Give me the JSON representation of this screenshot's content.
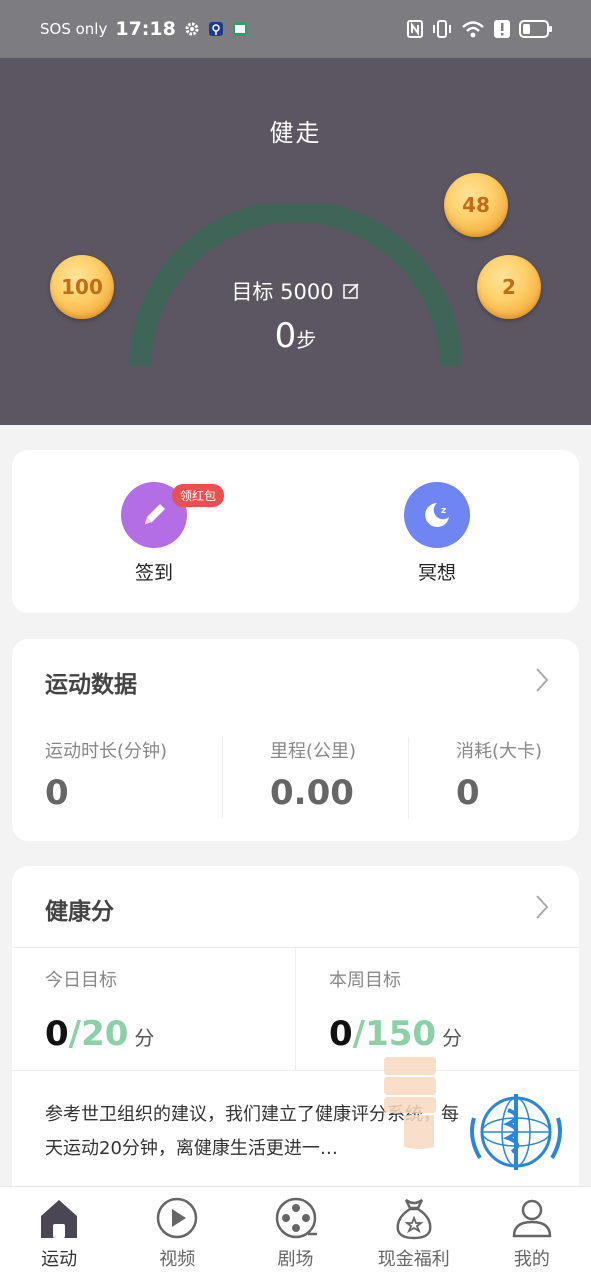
{
  "status_bar": {
    "carrier": "SOS only",
    "time": "17:18",
    "left_icons": [
      "gear-icon",
      "app-notification-icon",
      "app-notification-icon-2"
    ],
    "right_icons": [
      "nfc-icon",
      "vibrate-icon",
      "wifi-icon",
      "alert-icon",
      "battery-icon"
    ]
  },
  "hero": {
    "title": "健走",
    "goal_label": "目标 5000",
    "steps_value": "0",
    "steps_unit": "步",
    "gauge_color": "#3e6558",
    "background": "#5b5661",
    "coins": [
      "100",
      "48",
      "2"
    ]
  },
  "quick_actions": {
    "checkin_label": "签到",
    "checkin_badge": "领红包",
    "meditate_label": "冥想",
    "checkin_color": "#b36ee6",
    "meditate_color": "#6f86f2"
  },
  "exercise_data": {
    "title": "运动数据",
    "stats": [
      {
        "label": "运动时长(分钟)",
        "value": "0"
      },
      {
        "label": "里程(公里)",
        "value": "0.00"
      },
      {
        "label": "消耗(大卡)",
        "value": "0"
      }
    ]
  },
  "health_score": {
    "title": "健康分",
    "today": {
      "label": "今日目标",
      "current": "0",
      "target": "/20",
      "unit": "分"
    },
    "week": {
      "label": "本周目标",
      "current": "0",
      "target": "/150",
      "unit": "分"
    },
    "description": "参考世卫组织的建议，我们建立了健康评分系统，每天运动20分钟，离健康生活更进一…"
  },
  "tabs": [
    {
      "label": "运动",
      "icon": "home-icon",
      "active": true
    },
    {
      "label": "视频",
      "icon": "play-icon",
      "active": false
    },
    {
      "label": "剧场",
      "icon": "film-reel-icon",
      "active": false
    },
    {
      "label": "现金福利",
      "icon": "money-bag-icon",
      "active": false
    },
    {
      "label": "我的",
      "icon": "user-icon",
      "active": false
    }
  ]
}
